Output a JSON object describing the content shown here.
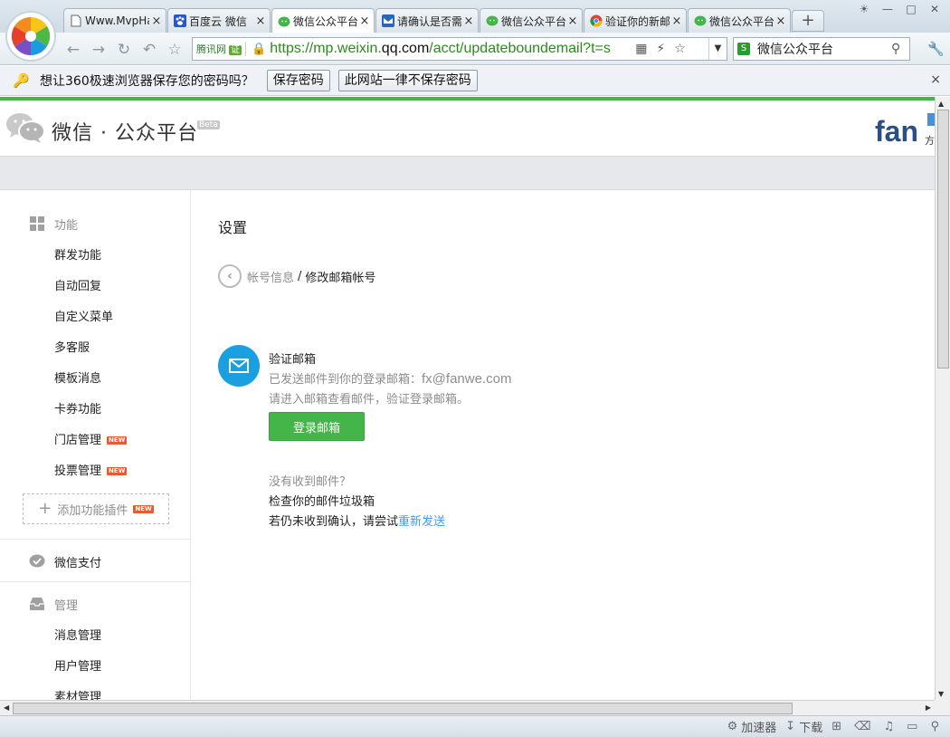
{
  "browser": {
    "tabs": [
      {
        "title": "Www.MvpHack",
        "favicon": "page-icon",
        "active": false
      },
      {
        "title": "百度云 微信",
        "favicon": "baidu-paw-icon",
        "active": false
      },
      {
        "title": "微信公众平台",
        "favicon": "wechat-icon",
        "active": true
      },
      {
        "title": "请确认是否需",
        "favicon": "qqmail-icon",
        "active": false
      },
      {
        "title": "微信公众平台",
        "favicon": "wechat-icon",
        "active": false
      },
      {
        "title": "验证你的新邮",
        "favicon": "chrome-icon",
        "active": false
      },
      {
        "title": "微信公众平台",
        "favicon": "wechat-icon",
        "active": false
      }
    ],
    "new_tab_label": "+",
    "address": {
      "site_id": "腾讯网",
      "cert_badge": "证",
      "url_prefix": "https://mp.weixin.",
      "url_domain": "qq.com",
      "url_path": "/acct/updateboundemail?t=s"
    },
    "search": {
      "engine_label": "S",
      "text": "微信公众平台"
    },
    "password_bar": {
      "message": "想让360极速浏览器保存您的密码吗？",
      "save_label": "保存密码",
      "never_label": "此网站一律不保存密码",
      "close": "×"
    },
    "status_bar": {
      "accelerator": "加速器",
      "download": "下载"
    },
    "colors": {
      "url_green": "#2b8a1e"
    }
  },
  "header": {
    "title": "微信 · 公众平台",
    "beta": "Beta",
    "partner_logo_text": "fan",
    "partner_logo_char": "方"
  },
  "sidebar": {
    "sections": [
      {
        "label": "功能",
        "icon": "grid-icon",
        "items": [
          {
            "label": "群发功能",
            "new": false
          },
          {
            "label": "自动回复",
            "new": false
          },
          {
            "label": "自定义菜单",
            "new": false
          },
          {
            "label": "多客服",
            "new": false
          },
          {
            "label": "模板消息",
            "new": false
          },
          {
            "label": "卡券功能",
            "new": false
          },
          {
            "label": "门店管理",
            "new": true
          },
          {
            "label": "投票管理",
            "new": true
          }
        ]
      },
      {
        "label": "微信支付",
        "icon": "wechat-pay-icon",
        "items": []
      },
      {
        "label": "管理",
        "icon": "inbox-icon",
        "items": [
          {
            "label": "消息管理",
            "new": false
          },
          {
            "label": "用户管理",
            "new": false
          },
          {
            "label": "素材管理",
            "new": false
          }
        ]
      }
    ],
    "add_plugin": "添加功能插件",
    "new_badge": "NEW"
  },
  "main": {
    "title": "设置",
    "breadcrumb": {
      "parent": "帐号信息",
      "sep": "/",
      "current": "修改邮箱帐号"
    },
    "verify": {
      "title": "验证邮箱",
      "sent_prefix": "已发送邮件到你的登录邮箱：",
      "email": "fx@fanwe.com",
      "hint": "请进入邮箱查看邮件，验证登录邮箱。",
      "login_button": "登录邮箱",
      "not_received": "没有收到邮件？",
      "check_spam": "检查你的邮件垃圾箱",
      "retry_prefix": "若仍未收到确认，请尝试",
      "resend_link": "重新发送"
    },
    "colors": {
      "primary_green": "#44b549",
      "mail_blue": "#1aa0e0",
      "link_blue": "#459ae9"
    }
  }
}
